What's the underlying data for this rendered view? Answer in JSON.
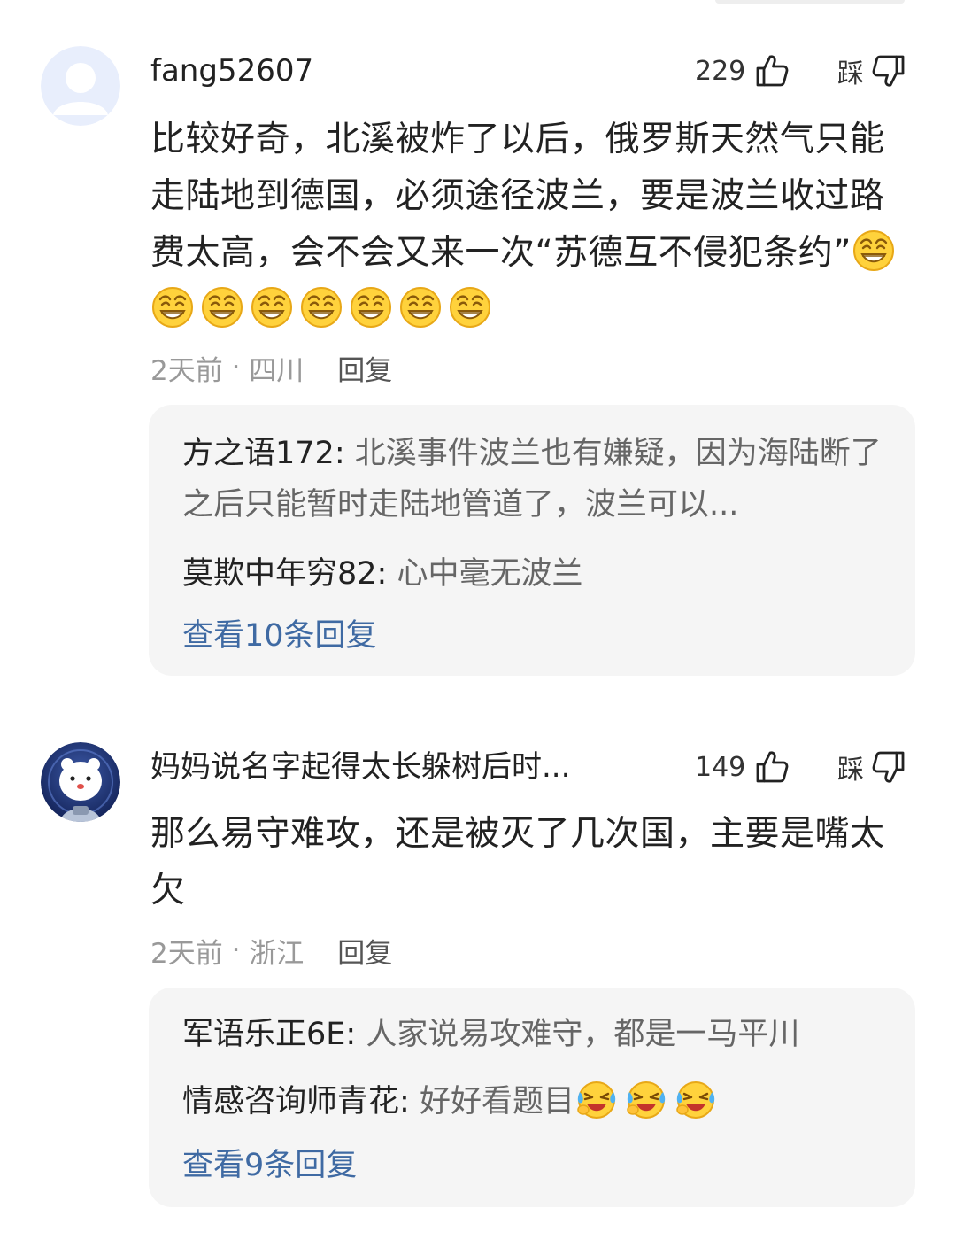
{
  "comments": [
    {
      "username": "fang52607",
      "like_count": "229",
      "dislike_label": "踩",
      "text": "比较好奇，北溪被炸了以后，俄罗斯天然气只能走陆地到德国，必须途径波兰，要是波兰收过路费太高，会不会又来一次“苏德互不侵犯条约”",
      "emoji_name": "smirk-grin-emoji",
      "emoji_count": 8,
      "time": "2天前",
      "location": "四川",
      "reply_label": "回复",
      "replies": [
        {
          "name": "方之语172",
          "text": "北溪事件波兰也有嫌疑，因为海陆断了之后只能暂时走陆地管道了，波兰可以..."
        },
        {
          "name": "莫欺中年穷82",
          "text": "心中毫无波兰"
        }
      ],
      "view_more": "查看10条回复"
    },
    {
      "username": "妈妈说名字起得太长躲树后时...",
      "like_count": "149",
      "dislike_label": "踩",
      "text": "那么易守难攻，还是被灭了几次国，主要是嘴太欠",
      "time": "2天前",
      "location": "浙江",
      "reply_label": "回复",
      "replies": [
        {
          "name": "军语乐正6E",
          "text": "人家说易攻难守，都是一马平川"
        },
        {
          "name": "情感咨询师青花",
          "text": "好好看题目",
          "emoji_name": "crying-laughing-emoji",
          "emoji_count": 3
        }
      ],
      "view_more": "查看9条回复"
    }
  ],
  "separator": " · ",
  "reply_colon": ": ",
  "colors": {
    "link": "#3f6aa3",
    "reply_bg": "#f5f5f5",
    "meta": "#999999",
    "text": "#222222"
  }
}
